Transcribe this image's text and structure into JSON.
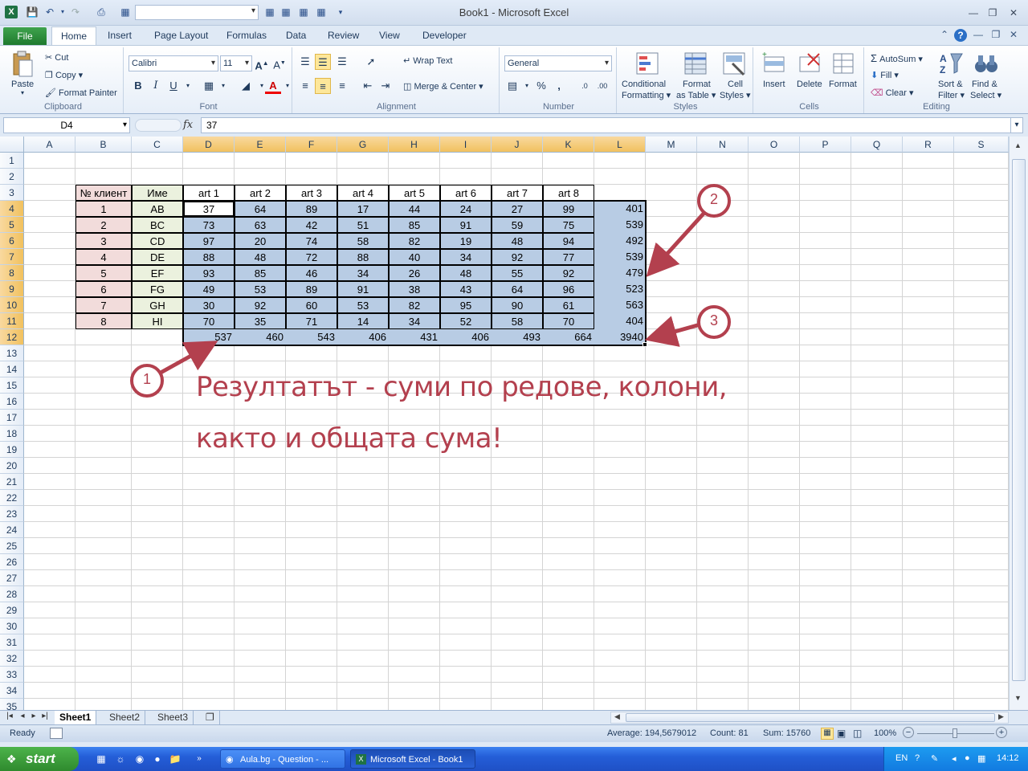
{
  "window": {
    "title": "Book1  -  Microsoft Excel",
    "logo": "X"
  },
  "ribbon_tabs": [
    "File",
    "Home",
    "Insert",
    "Page Layout",
    "Formulas",
    "Data",
    "Review",
    "View",
    "Developer"
  ],
  "ribbon": {
    "clipboard": {
      "label": "Clipboard",
      "paste": "Paste",
      "cut": "Cut",
      "copy": "Copy",
      "format_painter": "Format Painter"
    },
    "font": {
      "label": "Font",
      "name": "Calibri",
      "size": "11",
      "bold": "B",
      "italic": "I",
      "underline": "U"
    },
    "alignment": {
      "label": "Alignment",
      "wrap_text": "Wrap Text",
      "merge_center": "Merge & Center"
    },
    "number": {
      "label": "Number",
      "format": "General",
      "percent": "%",
      "comma": ","
    },
    "styles": {
      "label": "Styles",
      "conditional": "Conditional",
      "conditional2": "Formatting",
      "format_table": "Format",
      "format_table2": "as Table",
      "cell_styles": "Cell",
      "cell_styles2": "Styles"
    },
    "cells": {
      "label": "Cells",
      "insert": "Insert",
      "delete": "Delete",
      "format": "Format"
    },
    "editing": {
      "label": "Editing",
      "autosum": "AutoSum",
      "fill": "Fill",
      "clear": "Clear",
      "sort": "Sort &",
      "sort2": "Filter",
      "find": "Find &",
      "find2": "Select"
    }
  },
  "formula_bar": {
    "name_box": "D4",
    "fx": "fx",
    "value": "37"
  },
  "columns": [
    "A",
    "B",
    "C",
    "D",
    "E",
    "F",
    "G",
    "H",
    "I",
    "J",
    "K",
    "L",
    "M",
    "N",
    "O",
    "P",
    "Q",
    "R",
    "S"
  ],
  "rows": [
    "1",
    "2",
    "3",
    "4",
    "5",
    "6",
    "7",
    "8",
    "9",
    "10",
    "11",
    "12",
    "13",
    "14",
    "15",
    "16",
    "17",
    "18",
    "19",
    "20",
    "21",
    "22",
    "23",
    "24",
    "25",
    "26",
    "27",
    "28",
    "29",
    "30",
    "31",
    "32",
    "33",
    "34",
    "35"
  ],
  "table": {
    "header_num": "№ клиент",
    "header_name": "Име",
    "art_headers": [
      "art 1",
      "art 2",
      "art 3",
      "art 4",
      "art 5",
      "art 6",
      "art 7",
      "art 8"
    ],
    "rows": [
      {
        "num": "1",
        "name": "AB",
        "values": [
          "37",
          "64",
          "89",
          "17",
          "44",
          "24",
          "27",
          "99"
        ],
        "total": "401"
      },
      {
        "num": "2",
        "name": "BC",
        "values": [
          "73",
          "63",
          "42",
          "51",
          "85",
          "91",
          "59",
          "75"
        ],
        "total": "539"
      },
      {
        "num": "3",
        "name": "CD",
        "values": [
          "97",
          "20",
          "74",
          "58",
          "82",
          "19",
          "48",
          "94"
        ],
        "total": "492"
      },
      {
        "num": "4",
        "name": "DE",
        "values": [
          "88",
          "48",
          "72",
          "88",
          "40",
          "34",
          "92",
          "77"
        ],
        "total": "539"
      },
      {
        "num": "5",
        "name": "EF",
        "values": [
          "93",
          "85",
          "46",
          "34",
          "26",
          "48",
          "55",
          "92"
        ],
        "total": "479"
      },
      {
        "num": "6",
        "name": "FG",
        "values": [
          "49",
          "53",
          "89",
          "91",
          "38",
          "43",
          "64",
          "96"
        ],
        "total": "523"
      },
      {
        "num": "7",
        "name": "GH",
        "values": [
          "30",
          "92",
          "60",
          "53",
          "82",
          "95",
          "90",
          "61"
        ],
        "total": "563"
      },
      {
        "num": "8",
        "name": "HI",
        "values": [
          "70",
          "35",
          "71",
          "14",
          "34",
          "52",
          "58",
          "70"
        ],
        "total": "404"
      }
    ],
    "column_totals": [
      "537",
      "460",
      "543",
      "406",
      "431",
      "406",
      "493",
      "664"
    ],
    "grand_total": "3940"
  },
  "annotation": {
    "line1": "Резултатът - суми по редове, колони,",
    "line2": "както и общата сума!",
    "marker1": "1",
    "marker2": "2",
    "marker3": "3",
    "color": "#b3404e"
  },
  "sheets": [
    "Sheet1",
    "Sheet2",
    "Sheet3"
  ],
  "status": {
    "ready": "Ready",
    "average": "Average: 194,5679012",
    "count": "Count: 81",
    "sum": "Sum: 15760",
    "zoom": "100%"
  },
  "taskbar": {
    "start": "start",
    "tasks": [
      "Aula.bg - Question - ...",
      "Microsoft Excel - Book1"
    ],
    "lang": "EN",
    "time": "14:12"
  }
}
